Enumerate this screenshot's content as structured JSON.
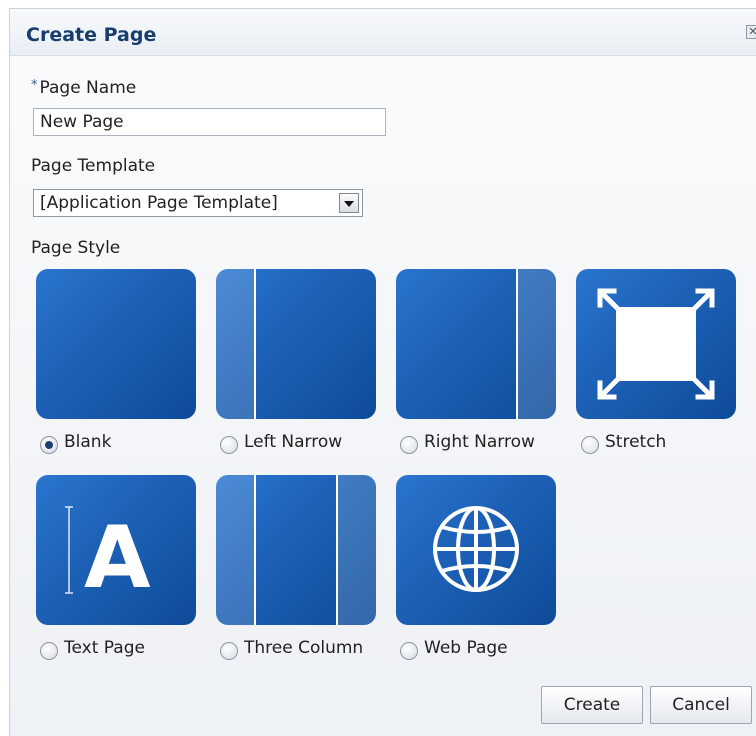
{
  "dialog": {
    "title": "Create Page",
    "close_icon": "close-icon"
  },
  "page_name": {
    "required_marker": "*",
    "label": "Page Name",
    "value": "New Page"
  },
  "page_template": {
    "label": "Page Template",
    "selected": "[Application Page Template]"
  },
  "page_style": {
    "label": "Page Style",
    "selected": "Blank",
    "options": [
      {
        "label": "Blank",
        "icon": "blank-layout-icon",
        "checked": true
      },
      {
        "label": "Left Narrow",
        "icon": "left-narrow-layout-icon",
        "checked": false
      },
      {
        "label": "Right Narrow",
        "icon": "right-narrow-layout-icon",
        "checked": false
      },
      {
        "label": "Stretch",
        "icon": "stretch-layout-icon",
        "checked": false
      },
      {
        "label": "Text Page",
        "icon": "text-page-icon",
        "checked": false
      },
      {
        "label": "Three Column",
        "icon": "three-column-layout-icon",
        "checked": false
      },
      {
        "label": "Web Page",
        "icon": "globe-icon",
        "checked": false
      }
    ]
  },
  "buttons": {
    "create": "Create",
    "cancel": "Cancel"
  },
  "colors": {
    "title": "#163d6c",
    "tile_blue": "#1e62b8"
  }
}
